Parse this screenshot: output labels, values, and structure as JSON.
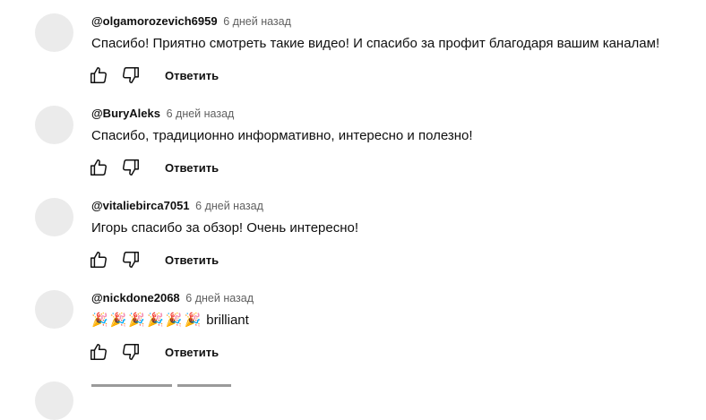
{
  "comments": [
    {
      "author": "@olgamorozevich6959",
      "time": "6 дней назад",
      "text": "Спасибо! Приятно смотреть такие видео! И спасибо за профит благодаря вашим каналам!",
      "reply_label": "Ответить"
    },
    {
      "author": "@BuryAleks",
      "time": "6 дней назад",
      "text": "Спасибо, традиционно информативно, интересно и полезно!",
      "reply_label": "Ответить"
    },
    {
      "author": "@vitaliebirca7051",
      "time": "6 дней назад",
      "text": "Игорь спасибо за обзор! Очень интересно!",
      "reply_label": "Ответить"
    },
    {
      "author": "@nickdone2068",
      "time": "6 дней назад",
      "emoji": [
        "🎉",
        "🎉",
        "🎉",
        "🎉",
        "🎉",
        "🎉"
      ],
      "text": "brilliant",
      "reply_label": "Ответить"
    }
  ],
  "icons": {
    "like": "thumb-up-icon",
    "dislike": "thumb-down-icon"
  }
}
